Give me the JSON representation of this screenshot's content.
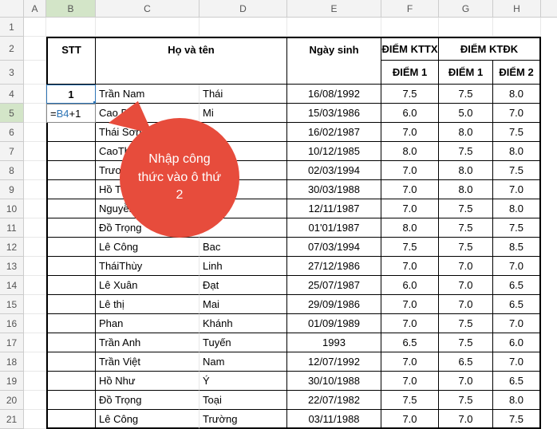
{
  "columns": [
    "A",
    "B",
    "C",
    "D",
    "E",
    "F",
    "G",
    "H"
  ],
  "selected_col": "B",
  "selected_row": 5,
  "header_rows": {
    "stt": "STT",
    "hoten": "Họ và tên",
    "ngaysinh": "Ngày sinh",
    "diem_kttx": "ĐIỂM KTTX",
    "diem_ktdk": "ĐIỂM KTĐK",
    "diem": "ĐIỂM",
    "d1": "1",
    "d2": "2"
  },
  "formula": {
    "prefix": "=",
    "ref": "B4",
    "suffix": "+1"
  },
  "first_stt": "1",
  "rows": [
    {
      "c": "Trần Nam",
      "d": "Thái",
      "e": "16/08/1992",
      "f": "7.5",
      "g": "7.5",
      "h": "8.0"
    },
    {
      "c": "Cao Bá",
      "d": "Mi",
      "e": "15/03/1986",
      "f": "6.0",
      "g": "5.0",
      "h": "7.0"
    },
    {
      "c": "Thái Sơn",
      "d": "",
      "e": "16/02/1987",
      "f": "7.0",
      "g": "8.0",
      "h": "7.5"
    },
    {
      "c": "CaoThu",
      "d": "",
      "e": "10/12/1985",
      "f": "8.0",
      "g": "7.5",
      "h": "8.0"
    },
    {
      "c": "Trương T",
      "d": "",
      "e": "02/03/1994",
      "f": "7.0",
      "g": "8.0",
      "h": "7.5"
    },
    {
      "c": "Hồ Than",
      "d": "",
      "e": "30/03/1988",
      "f": "7.0",
      "g": "8.0",
      "h": "7.0"
    },
    {
      "c": "Nguyễn N",
      "d": "",
      "e": "12/11/1987",
      "f": "7.0",
      "g": "7.5",
      "h": "8.0"
    },
    {
      "c": "Đồ Trọng",
      "d": "",
      "e": "01'01/1987",
      "f": "8.0",
      "g": "7.5",
      "h": "7.5"
    },
    {
      "c": "Lê Công",
      "d": "Bac",
      "e": "07/03/1994",
      "f": "7.5",
      "g": "7.5",
      "h": "8.5"
    },
    {
      "c": "TháiThùy",
      "d": "Linh",
      "e": "27/12/1986",
      "f": "7.0",
      "g": "7.0",
      "h": "7.0"
    },
    {
      "c": "Lê Xuân",
      "d": "Đạt",
      "e": "25/07/1987",
      "f": "6.0",
      "g": "7.0",
      "h": "6.5"
    },
    {
      "c": "Lê thị",
      "d": "Mai",
      "e": "29/09/1986",
      "f": "7.0",
      "g": "7.0",
      "h": "6.5"
    },
    {
      "c": "Phan",
      "d": "Khánh",
      "e": "01/09/1989",
      "f": "7.0",
      "g": "7.5",
      "h": "7.0"
    },
    {
      "c": "Trần Anh",
      "d": "Tuyến",
      "e": "1993",
      "f": "6.5",
      "g": "7.5",
      "h": "6.0"
    },
    {
      "c": "Trần Việt",
      "d": "Nam",
      "e": "12/07/1992",
      "f": "7.0",
      "g": "6.5",
      "h": "7.0"
    },
    {
      "c": "Hồ Như",
      "d": "Ý",
      "e": "30/10/1988",
      "f": "7.0",
      "g": "7.0",
      "h": "6.5"
    },
    {
      "c": "Đồ Trọng",
      "d": "Toại",
      "e": "22/07/1982",
      "f": "7.5",
      "g": "7.5",
      "h": "8.0"
    },
    {
      "c": "Lê Công",
      "d": "Trường",
      "e": "03/11/1988",
      "f": "7.0",
      "g": "7.0",
      "h": "7.5"
    }
  ],
  "callout": "Nhập công thức vào ô thứ 2"
}
